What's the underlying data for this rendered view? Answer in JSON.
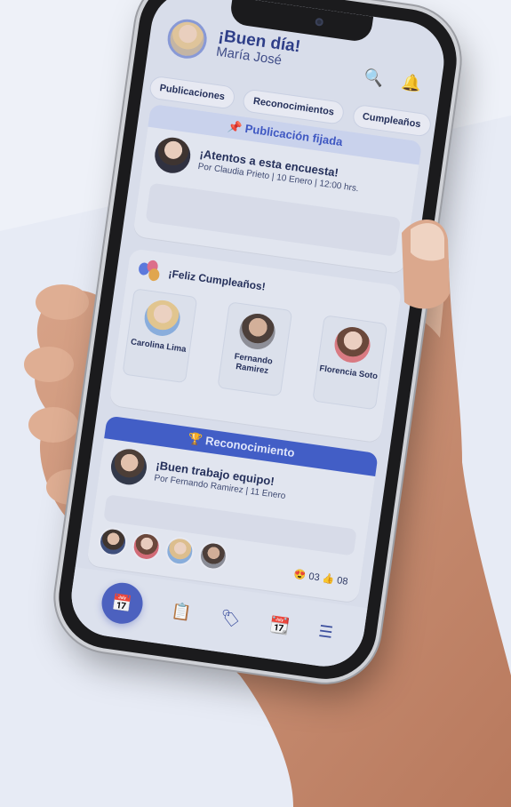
{
  "header": {
    "greeting": "¡Buen día!",
    "name": "María José"
  },
  "tabs": [
    "Publicaciones",
    "Reconocimientos",
    "Cumpleaños"
  ],
  "pinned": {
    "label": "Publicación fijada",
    "title": "¡Atentos a esta encuesta!",
    "meta": "Por Claudia Prieto | 10 Enero | 12:00 hrs."
  },
  "birthdays": {
    "title": "¡Feliz Cumpleaños!",
    "people": [
      {
        "name": "Carolina Lima"
      },
      {
        "name": "Fernando Ramirez"
      },
      {
        "name": "Florencia Soto"
      }
    ]
  },
  "recognition": {
    "label": "Reconocimiento",
    "title": "¡Buen trabajo equipo!",
    "meta": "Por Fernando Ramirez | 11 Enero",
    "reaction_a": "03",
    "reaction_b": "08"
  },
  "nav": {
    "icons": [
      "calendar-icon",
      "clipboard-icon",
      "tag-icon",
      "calendar-notification-icon",
      "menu-icon"
    ]
  },
  "colors": {
    "primary": "#3f5cc8",
    "primary_dark": "#2a3a86",
    "light_bar": "#cfd7f1"
  }
}
